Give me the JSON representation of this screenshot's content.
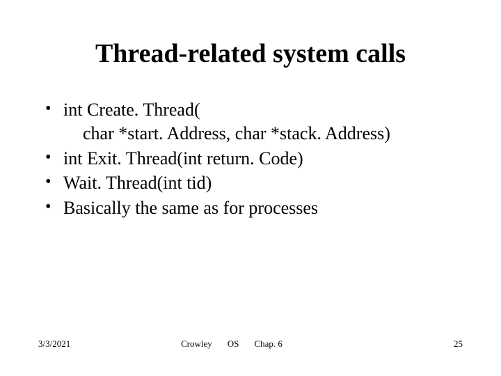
{
  "title": "Thread-related system calls",
  "bullets": {
    "b1_line1": "int Create. Thread(",
    "b1_line2": "char *start. Address, char *stack. Address)",
    "b2": "int Exit. Thread(int return. Code)",
    "b3": "Wait. Thread(int tid)",
    "b4": "Basically the same as for processes"
  },
  "footer": {
    "date": "3/3/2021",
    "author": "Crowley",
    "course": "OS",
    "chapter": "Chap. 6",
    "page": "25"
  }
}
